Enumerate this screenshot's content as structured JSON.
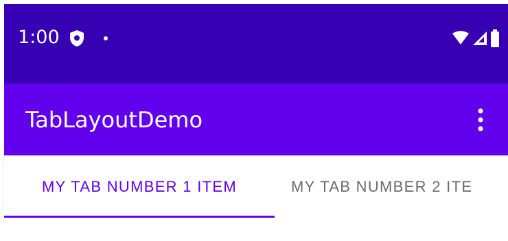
{
  "status_bar": {
    "time": "1:00",
    "icons": [
      "shield-icon",
      "notification-dot-icon",
      "wifi-icon",
      "cell-signal-icon",
      "battery-icon"
    ],
    "background": "#3700b3"
  },
  "app_bar": {
    "title": "TabLayoutDemo",
    "menu_icon": "more-vert-icon",
    "background": "#6200ee"
  },
  "tabs": [
    {
      "label": "MY TAB NUMBER 1 ITEM",
      "selected": true
    },
    {
      "label": "MY TAB NUMBER 2 ITE",
      "selected": false
    }
  ],
  "colors": {
    "accent": "#6200ee",
    "tab_inactive": "#6b6b6b",
    "text_on_primary": "#ffffff"
  }
}
